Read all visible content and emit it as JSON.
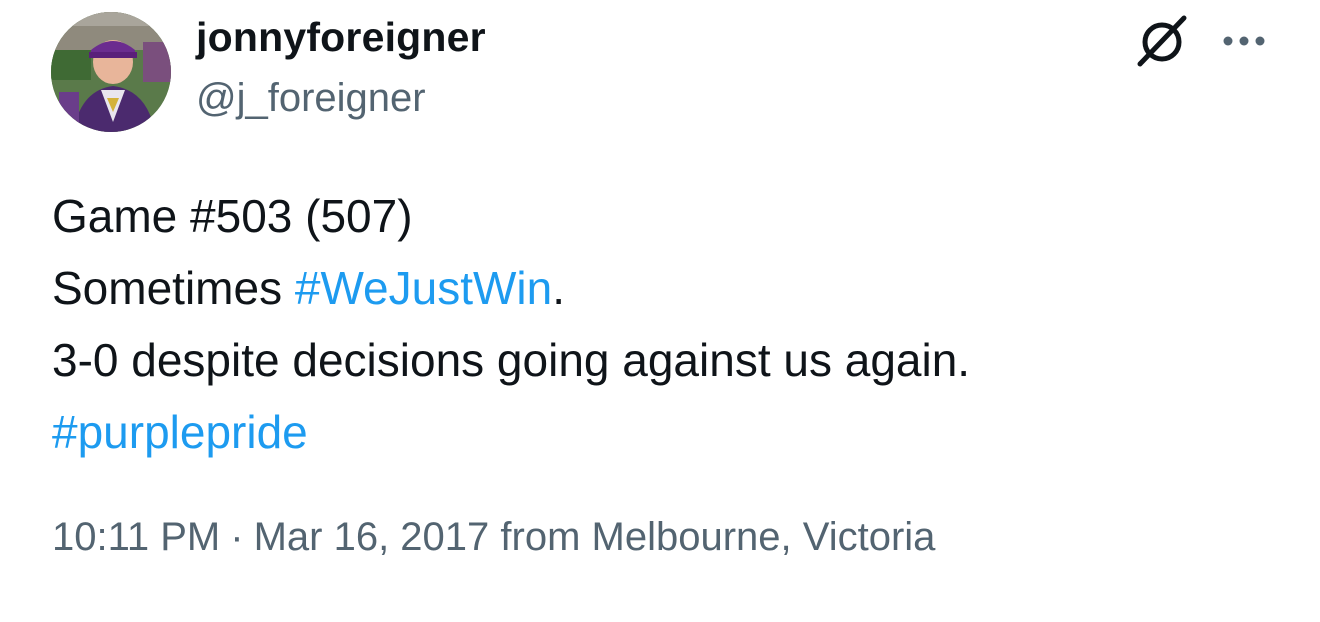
{
  "user": {
    "display_name": "jonnyforeigner",
    "handle": "@j_foreigner"
  },
  "header": {
    "brand_icon": "slashed-circle-icon",
    "more_icon": "more-dots-icon"
  },
  "tweet": {
    "line1": "Game #503 (507)",
    "line2_prefix": "Sometimes ",
    "line2_hashtag": "#WeJustWin",
    "line2_suffix": ".",
    "line3": "3-0 despite decisions going against us again.",
    "line4_hashtag": "#purplepride"
  },
  "meta": {
    "time": "10:11 PM",
    "separator": "·",
    "date_location": "Mar 16, 2017 from Melbourne, Victoria"
  },
  "colors": {
    "text": "#0f1419",
    "secondary": "#536471",
    "link": "#1d9bf0"
  }
}
